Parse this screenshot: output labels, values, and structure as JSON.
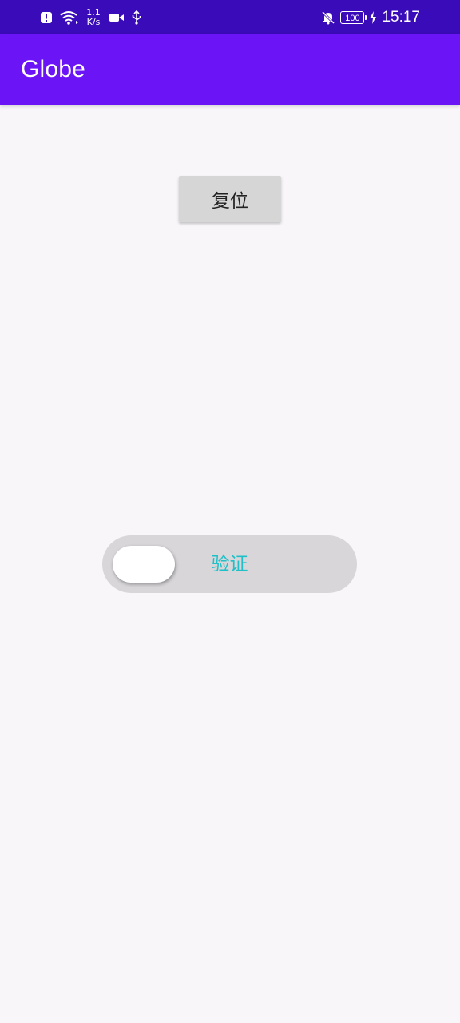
{
  "status_bar": {
    "net_speed_value": "1.1",
    "net_speed_unit": "K/s",
    "battery_level": "100",
    "time": "15:17",
    "icons": {
      "alert": "alert-icon",
      "wifi": "wifi-icon",
      "video": "video-camera-icon",
      "usb": "usb-icon",
      "mute": "notifications-off-icon",
      "charging": "charging-bolt-icon"
    }
  },
  "app_bar": {
    "title": "Globe",
    "color": "#6b14f5"
  },
  "main": {
    "reset_label": "复位",
    "verify_label": "验证",
    "verify_label_color": "#1fc0c8",
    "slider_progress": 0
  }
}
